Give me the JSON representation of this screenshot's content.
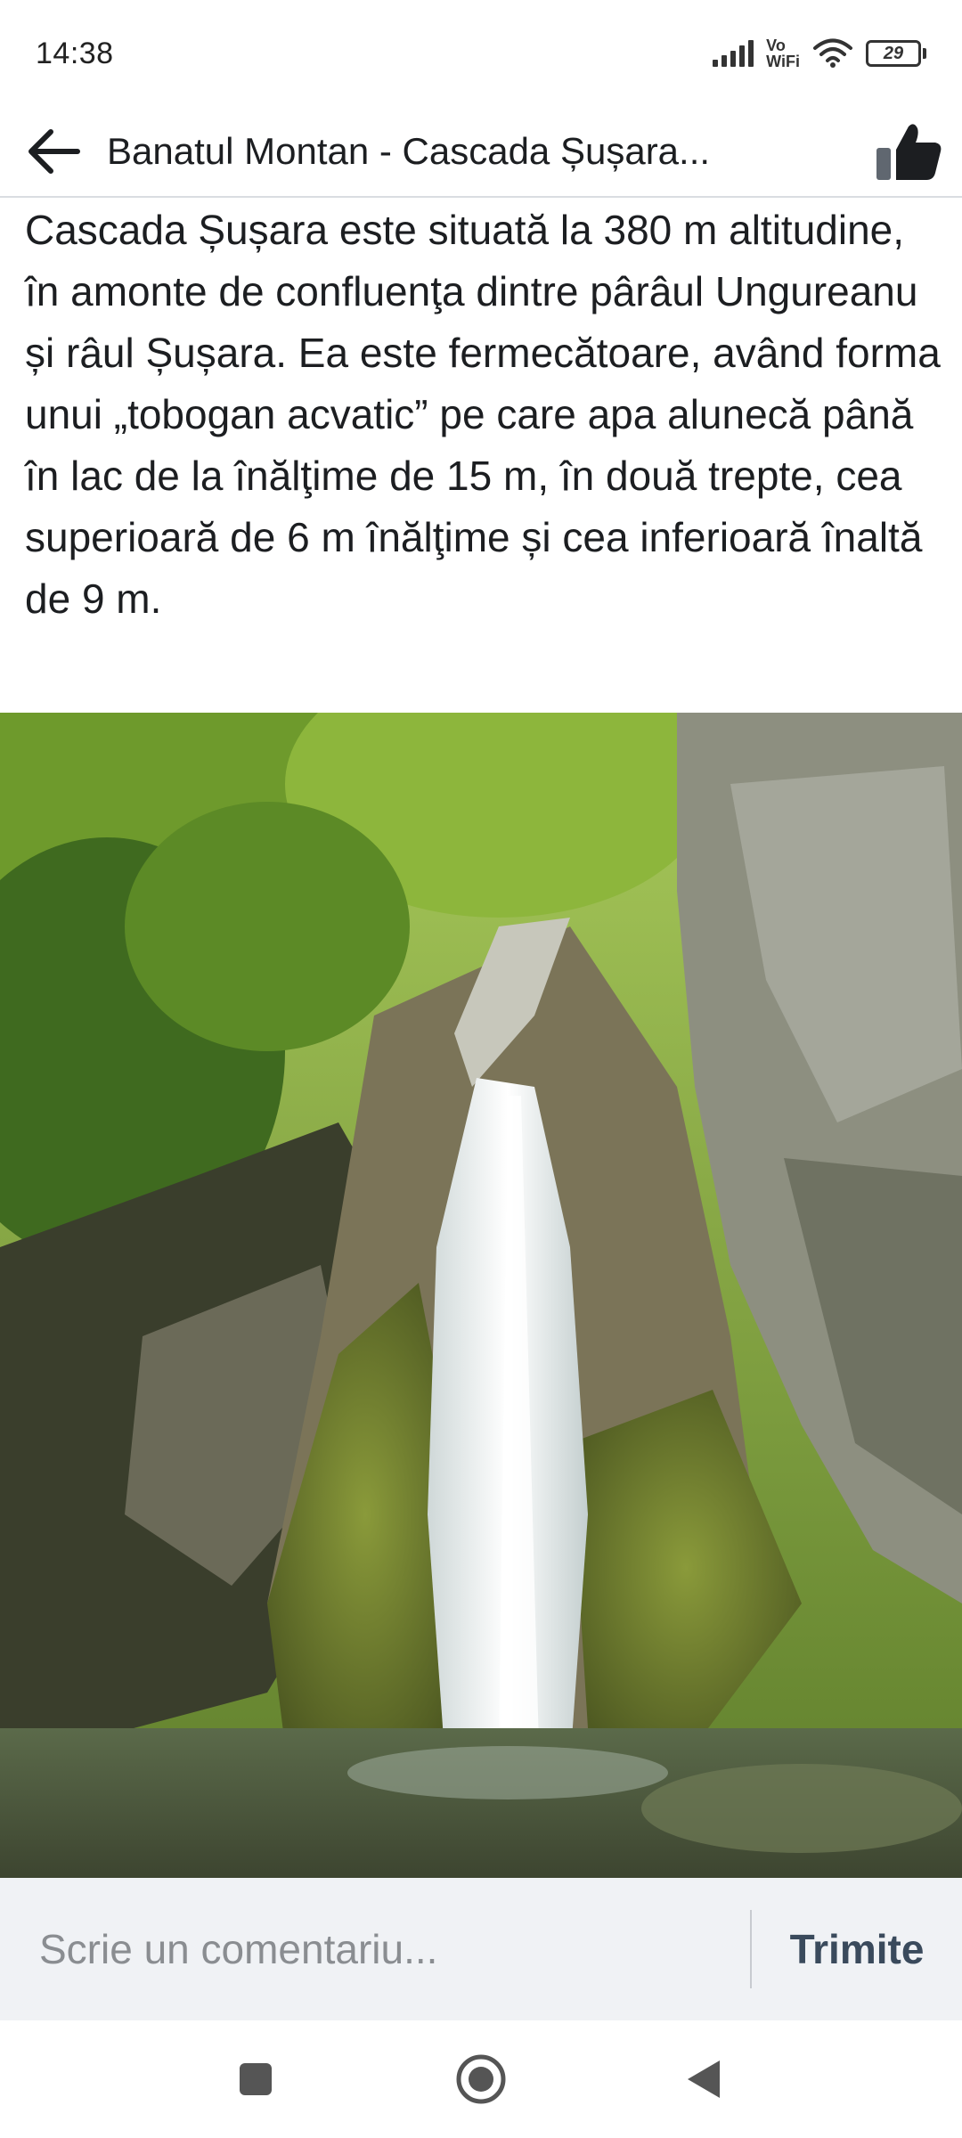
{
  "status_bar": {
    "time": "14:38",
    "network_label_top": "Vo",
    "network_label_bottom": "WiFi",
    "battery_level": "29",
    "icons": [
      "signal-icon",
      "wifi-icon",
      "battery-icon"
    ]
  },
  "header": {
    "title": "Banatul Montan - Cascada Șușara...",
    "back_icon": "arrow-left-icon",
    "like_icon": "thumbs-up-icon"
  },
  "post": {
    "text": "Cascada Șușara este situată la 380 m altitudine, în amonte de confluenţa dintre pârâul Ungureanu și râul Șușara. Ea este fermecătoare, având forma unui „tobogan acvatic” pe care apa alunecă până în lac de la înălţime de 15 m, în două trepte, cea superioară de 6 m înălţime și cea inferioară înaltă de 9 m."
  },
  "comment_bar": {
    "placeholder": "Scrie un comentariu...",
    "send_label": "Trimite"
  },
  "nav_bar": {
    "icons": [
      "recents-icon",
      "home-icon",
      "back-icon"
    ]
  },
  "colors": {
    "text": "#1c1e21",
    "placeholder": "#8a8d91",
    "comment_bar_bg": "#f0f2f5",
    "send_button": "#3a4a5c"
  }
}
